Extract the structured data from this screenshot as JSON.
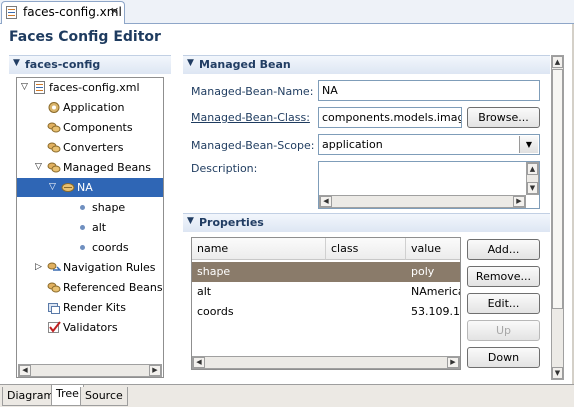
{
  "tab": {
    "title": "faces-config.xml",
    "close": "✕"
  },
  "page_title": "Faces Config Editor",
  "tree_section": {
    "title": "faces-config"
  },
  "tree": {
    "root": "faces-config.xml",
    "items": [
      {
        "label": "Application"
      },
      {
        "label": "Components"
      },
      {
        "label": "Converters"
      },
      {
        "label": "Managed Beans"
      },
      {
        "label": "NA"
      },
      {
        "label": "shape"
      },
      {
        "label": "alt"
      },
      {
        "label": "coords"
      },
      {
        "label": "Navigation Rules"
      },
      {
        "label": "Referenced Beans"
      },
      {
        "label": "Render Kits"
      },
      {
        "label": "Validators"
      }
    ]
  },
  "managed_bean": {
    "title": "Managed Bean",
    "name_label": "Managed-Bean-Name:",
    "name_value": "NA",
    "class_label": "Managed-Bean-Class:",
    "class_value": "components.models.image",
    "browse": "Browse...",
    "scope_label": "Managed-Bean-Scope:",
    "scope_value": "application",
    "description_label": "Description:"
  },
  "properties": {
    "title": "Properties",
    "columns": [
      "name",
      "class",
      "value"
    ],
    "rows": [
      {
        "name": "shape",
        "class": "",
        "value": "poly"
      },
      {
        "name": "alt",
        "class": "",
        "value": "NAmerica"
      },
      {
        "name": "coords",
        "class": "",
        "value": "53.109.1"
      }
    ],
    "buttons": {
      "add": "Add...",
      "remove": "Remove...",
      "edit": "Edit...",
      "up": "Up",
      "down": "Down"
    }
  },
  "bottom_tabs": [
    "Diagram",
    "Tree",
    "Source"
  ],
  "colors": {
    "accent": "#2f66b5",
    "heading": "#1e3b5f",
    "selected_row": "#8a7b6a"
  }
}
